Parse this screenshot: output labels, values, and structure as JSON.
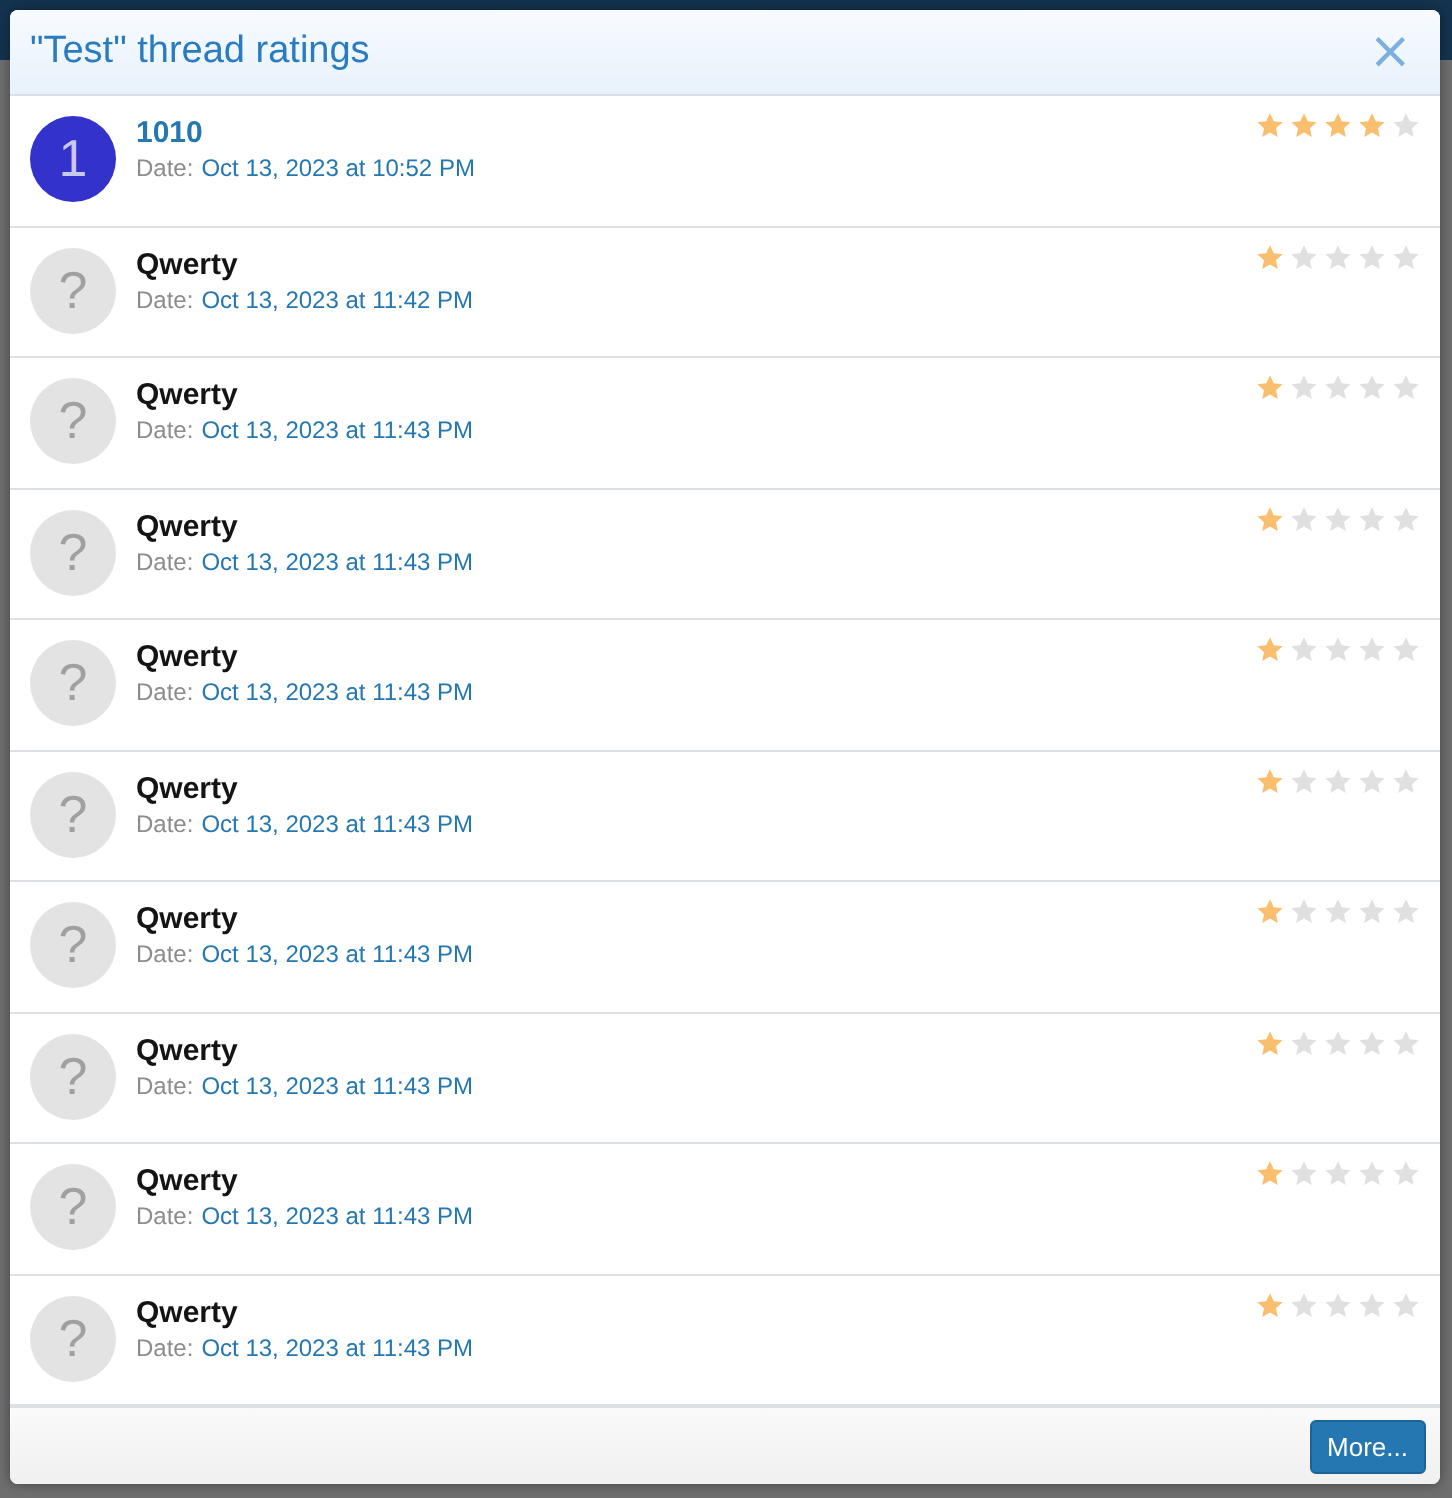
{
  "dialog": {
    "title": "\"Test\" thread ratings",
    "close": "×"
  },
  "ratings": [
    {
      "kind": "link",
      "avatar": {
        "kind": "letter",
        "text": "1",
        "color": "#3333cc"
      },
      "name": "1010",
      "date_label": "Date:",
      "date": "Oct 13, 2023 at 10:52 PM",
      "stars": 4
    },
    {
      "kind": "plain",
      "avatar": {
        "kind": "default",
        "text": "?"
      },
      "name": "Qwerty",
      "date_label": "Date:",
      "date": "Oct 13, 2023 at 11:42 PM",
      "stars": 1
    },
    {
      "kind": "plain",
      "avatar": {
        "kind": "default",
        "text": "?"
      },
      "name": "Qwerty",
      "date_label": "Date:",
      "date": "Oct 13, 2023 at 11:43 PM",
      "stars": 1
    },
    {
      "kind": "plain",
      "avatar": {
        "kind": "default",
        "text": "?"
      },
      "name": "Qwerty",
      "date_label": "Date:",
      "date": "Oct 13, 2023 at 11:43 PM",
      "stars": 1
    },
    {
      "kind": "plain",
      "avatar": {
        "kind": "default",
        "text": "?"
      },
      "name": "Qwerty",
      "date_label": "Date:",
      "date": "Oct 13, 2023 at 11:43 PM",
      "stars": 1
    },
    {
      "kind": "plain",
      "avatar": {
        "kind": "default",
        "text": "?"
      },
      "name": "Qwerty",
      "date_label": "Date:",
      "date": "Oct 13, 2023 at 11:43 PM",
      "stars": 1
    },
    {
      "kind": "plain",
      "avatar": {
        "kind": "default",
        "text": "?"
      },
      "name": "Qwerty",
      "date_label": "Date:",
      "date": "Oct 13, 2023 at 11:43 PM",
      "stars": 1
    },
    {
      "kind": "plain",
      "avatar": {
        "kind": "default",
        "text": "?"
      },
      "name": "Qwerty",
      "date_label": "Date:",
      "date": "Oct 13, 2023 at 11:43 PM",
      "stars": 1
    },
    {
      "kind": "plain",
      "avatar": {
        "kind": "default",
        "text": "?"
      },
      "name": "Qwerty",
      "date_label": "Date:",
      "date": "Oct 13, 2023 at 11:43 PM",
      "stars": 1
    },
    {
      "kind": "plain",
      "avatar": {
        "kind": "default",
        "text": "?"
      },
      "name": "Qwerty",
      "date_label": "Date:",
      "date": "Oct 13, 2023 at 11:43 PM",
      "stars": 1
    }
  ],
  "footer": {
    "more_button": "More..."
  }
}
